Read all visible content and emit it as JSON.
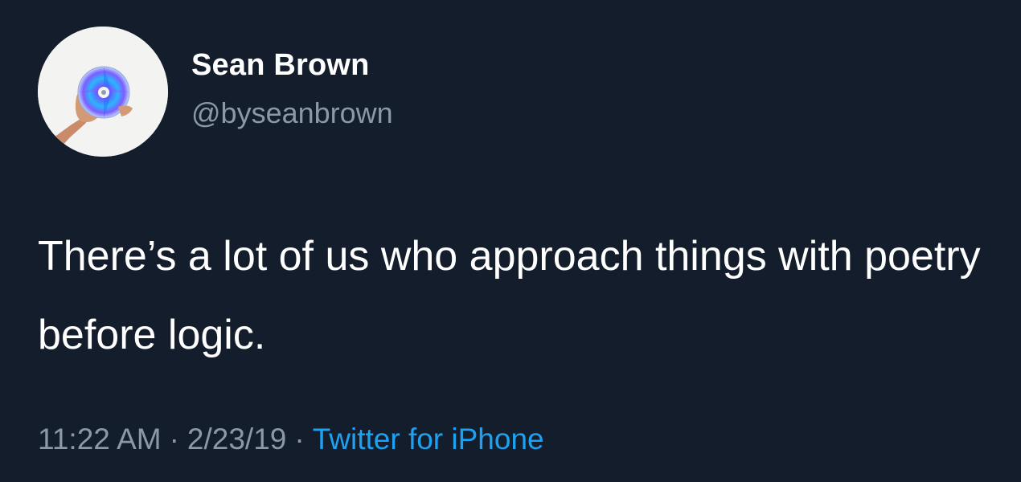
{
  "author": {
    "display_name": "Sean Brown",
    "handle": "@byseanbrown",
    "avatar_icon": "hand-holding-cd-icon"
  },
  "tweet": {
    "text": "There’s a lot of us who approach things with poetry before logic."
  },
  "meta": {
    "time": "11:22 AM",
    "separator": "·",
    "date": "2/23/19",
    "source": "Twitter for iPhone"
  },
  "colors": {
    "background": "#141d2b",
    "text": "#ffffff",
    "secondary": "#8a98a8",
    "link": "#1da1f2"
  }
}
